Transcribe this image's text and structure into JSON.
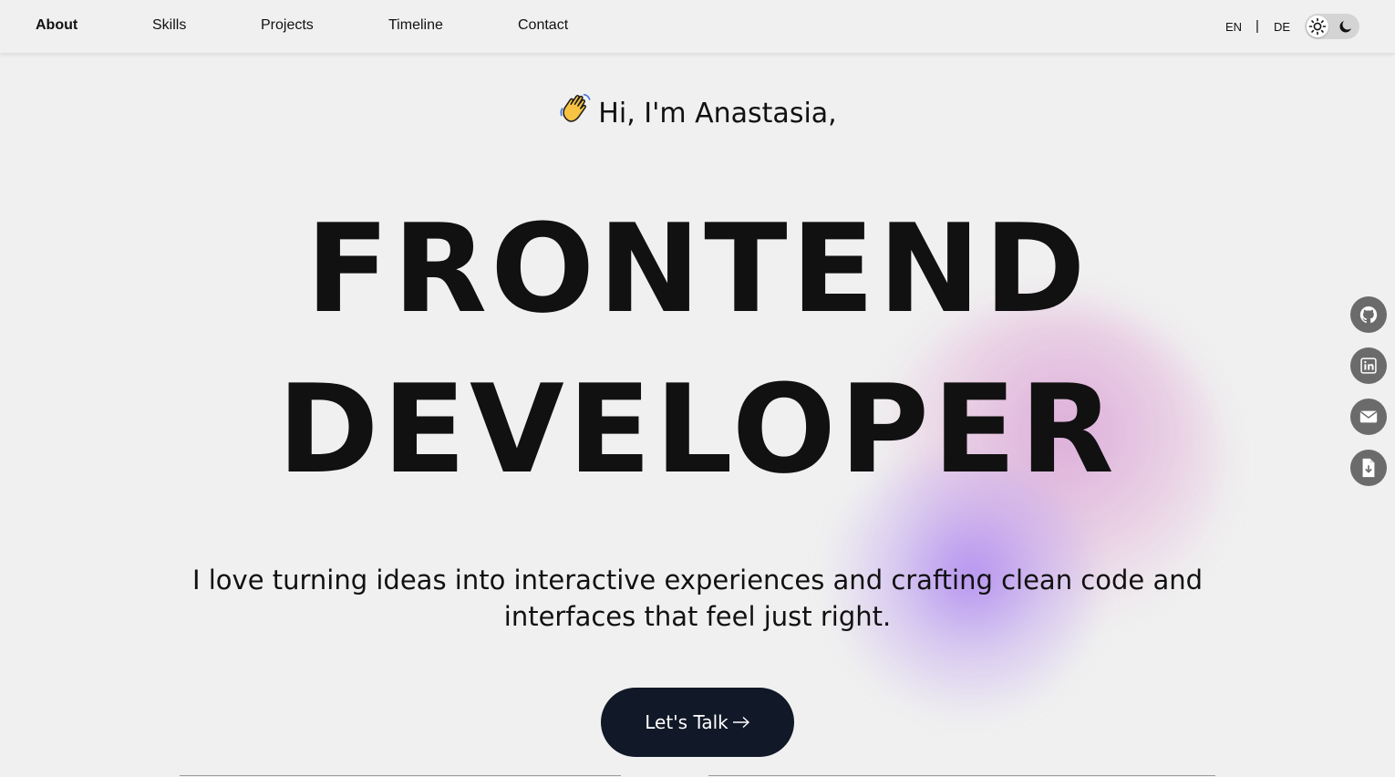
{
  "nav": {
    "items": [
      {
        "label": "About",
        "active": true
      },
      {
        "label": "Skills",
        "active": false
      },
      {
        "label": "Projects",
        "active": false
      },
      {
        "label": "Timeline",
        "active": false
      },
      {
        "label": "Contact",
        "active": false
      }
    ],
    "languages": [
      "EN",
      "DE"
    ],
    "language_separator": "|",
    "theme_toggle": {
      "icons": [
        "sun-icon",
        "moon-icon"
      ]
    }
  },
  "hero": {
    "greeting_icon": "waving-hand-icon",
    "greeting": "Hi, I'm Anastasia,",
    "headline_line1": "FRONTEND",
    "headline_line2": "DEVELOPER",
    "tagline": "I love turning ideas into interactive experiences and crafting clean code and interfaces that feel just right.",
    "cta_label": "Let's Talk",
    "cta_icon": "arrow-right-icon"
  },
  "social": [
    {
      "icon": "github-icon"
    },
    {
      "icon": "linkedin-icon"
    },
    {
      "icon": "mail-icon"
    },
    {
      "icon": "resume-download-icon"
    }
  ],
  "colors": {
    "background": "#f0f0f0",
    "text": "#111111",
    "cta_background": "#111827",
    "social_background": "#6b6b6b",
    "blob_pink": "#d696d2",
    "blob_violet": "#aa82f0"
  }
}
